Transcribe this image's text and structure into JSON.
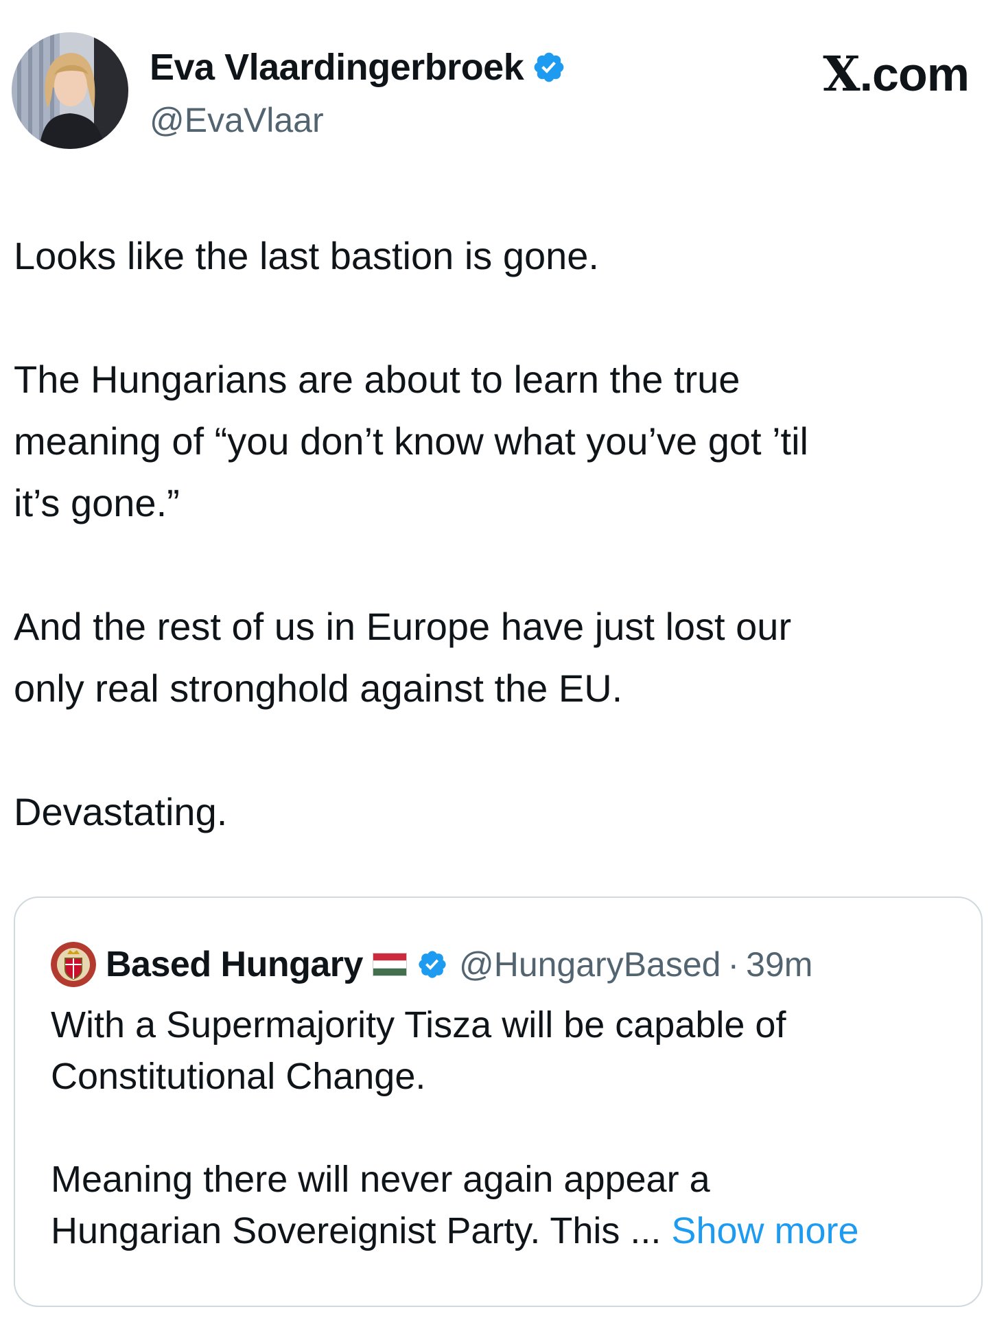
{
  "post": {
    "author_name": "Eva Vlaardingerbroek",
    "author_handle": "@EvaVlaar",
    "brand": "X.com",
    "paragraphs": [
      [
        "Looks like the last bastion is gone."
      ],
      [
        "The Hungarians are about to learn the true",
        "meaning of “you don’t know what you’ve got ’til",
        "it’s gone.”"
      ],
      [
        "And the rest of us in Europe have just lost our",
        "only real stronghold against the EU."
      ],
      [
        "Devastating."
      ]
    ]
  },
  "quote": {
    "author_name": "Based Hungary",
    "flag_icon": "hungary-flag-icon",
    "author_handle": "@HungaryBased",
    "separator": "·",
    "time": "39m",
    "line1": "With a Supermajority Tisza will be capable of",
    "line2": "Constitutional Change.",
    "line3": "Meaning there will never again appear a",
    "line4_text": "Hungarian Sovereignist Party. This ... ",
    "show_more": "Show more"
  },
  "colors": {
    "accent": "#1d9bf0",
    "muted": "#536471",
    "border": "#cfd9de"
  }
}
